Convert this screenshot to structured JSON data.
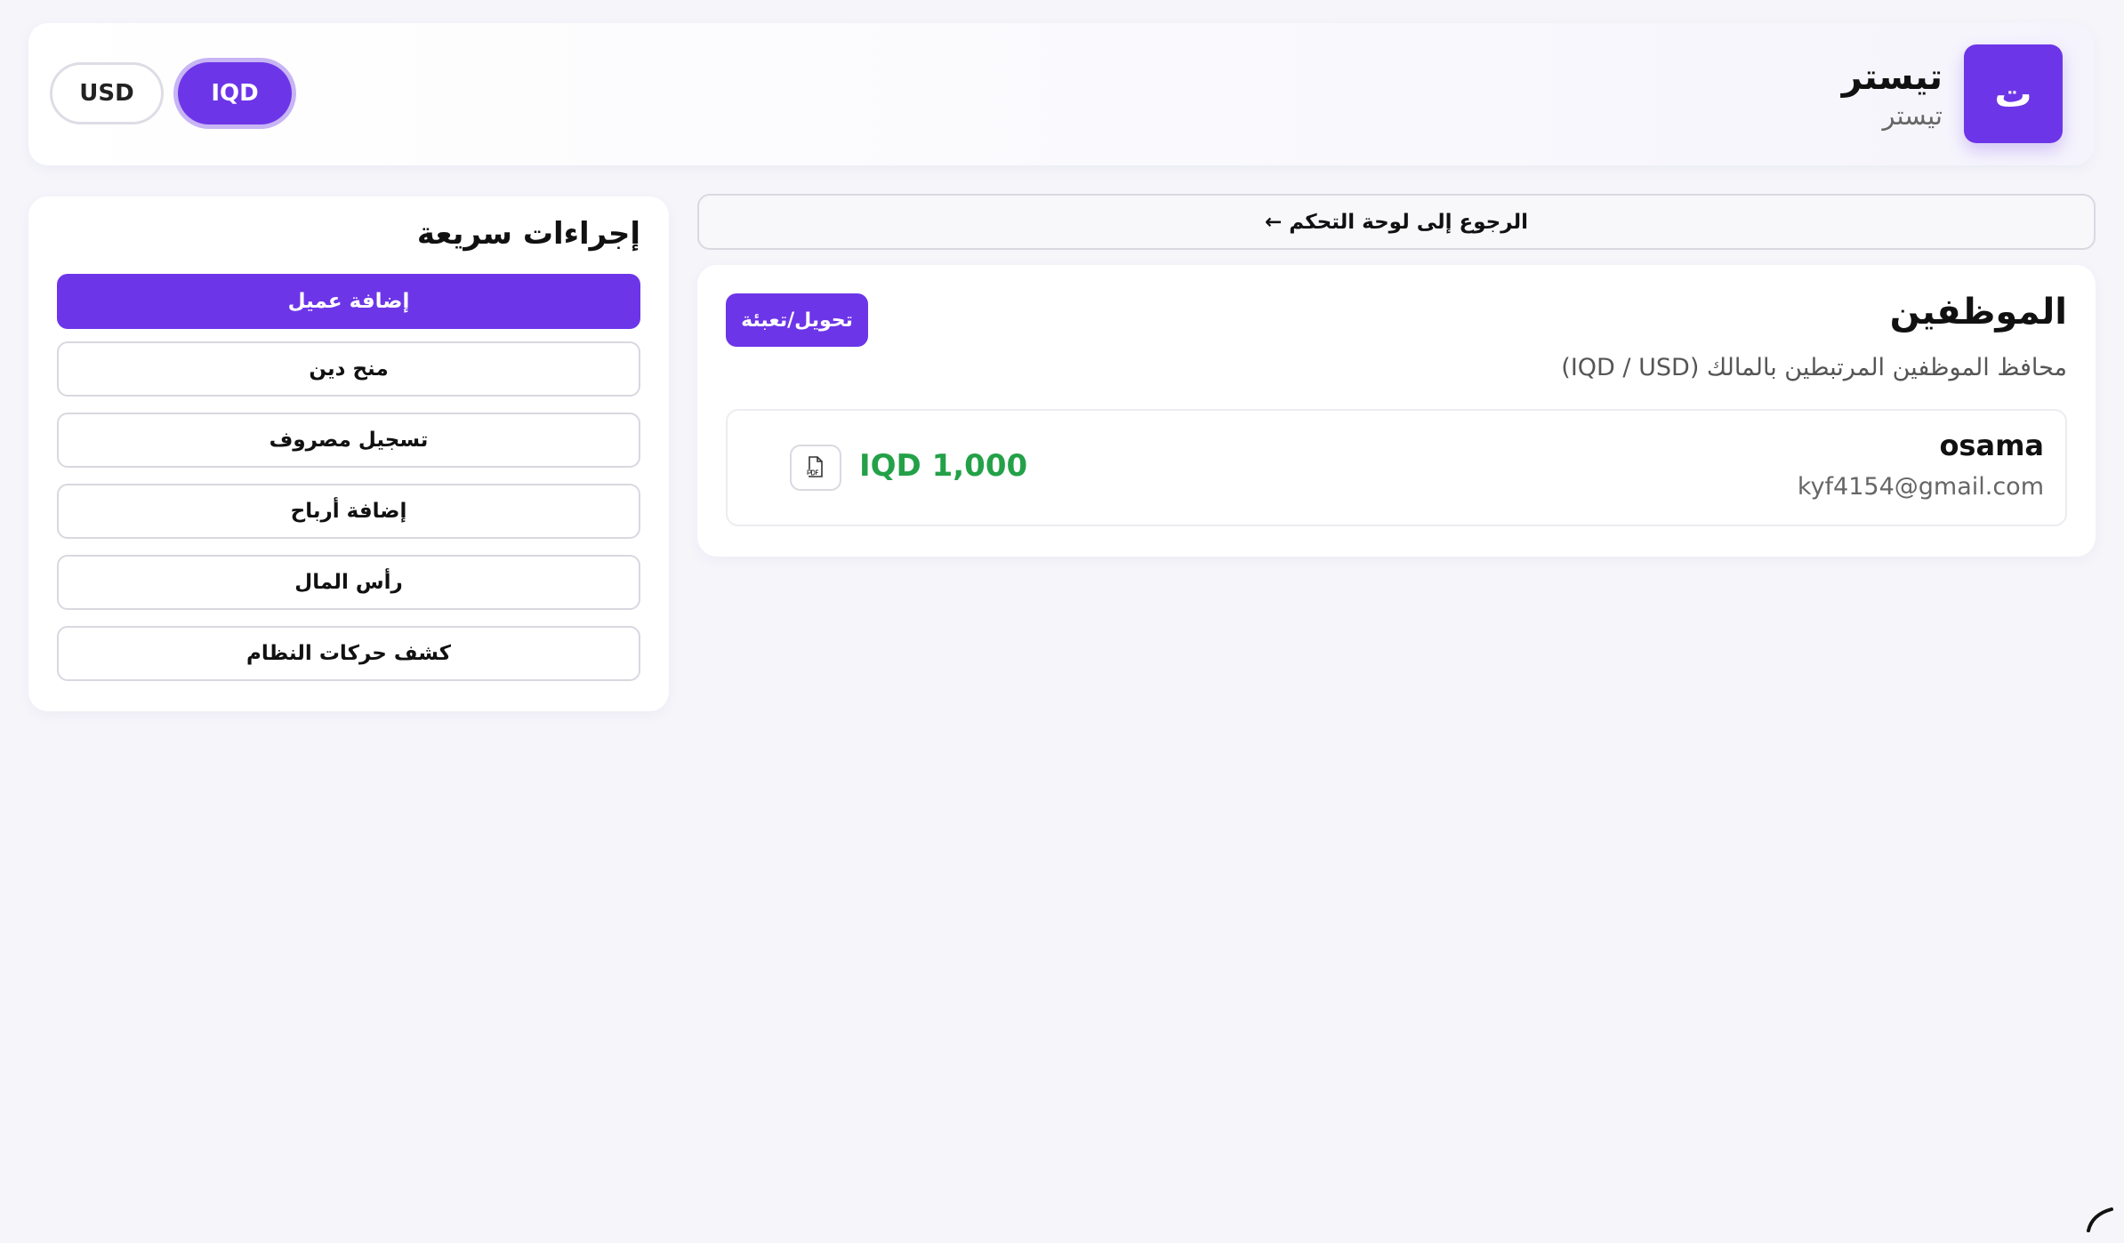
{
  "header": {
    "logo_letter": "ت",
    "title": "تيستر",
    "subtitle": "تيستر",
    "currency": {
      "iqd": "IQD",
      "usd": "USD",
      "selected": "IQD"
    }
  },
  "quick_actions": {
    "title": "إجراءات سريعة",
    "items": [
      {
        "label": "إضافة عميل"
      },
      {
        "label": "منح دين"
      },
      {
        "label": "تسجيل مصروف"
      },
      {
        "label": "إضافة أرباح"
      },
      {
        "label": "رأس المال"
      },
      {
        "label": "كشف حركات النظام"
      }
    ]
  },
  "main": {
    "back_label": "الرجوع إلى لوحة التحكم ←",
    "staff": {
      "title": "الموظفين",
      "subtitle": "محافظ الموظفين المرتبطين بالمالك (IQD / USD)",
      "transfer_label": "تحويل/تعبئة",
      "employees": [
        {
          "name": "osama",
          "email": "kyf4154@gmail.com",
          "balance": "IQD 1,000"
        }
      ]
    }
  },
  "colors": {
    "accent": "#6d35e8",
    "positive": "#24a148",
    "background": "#f5f5fa"
  },
  "icons": {
    "pdf": "pdf-file-icon",
    "corner": "spinner-icon"
  }
}
